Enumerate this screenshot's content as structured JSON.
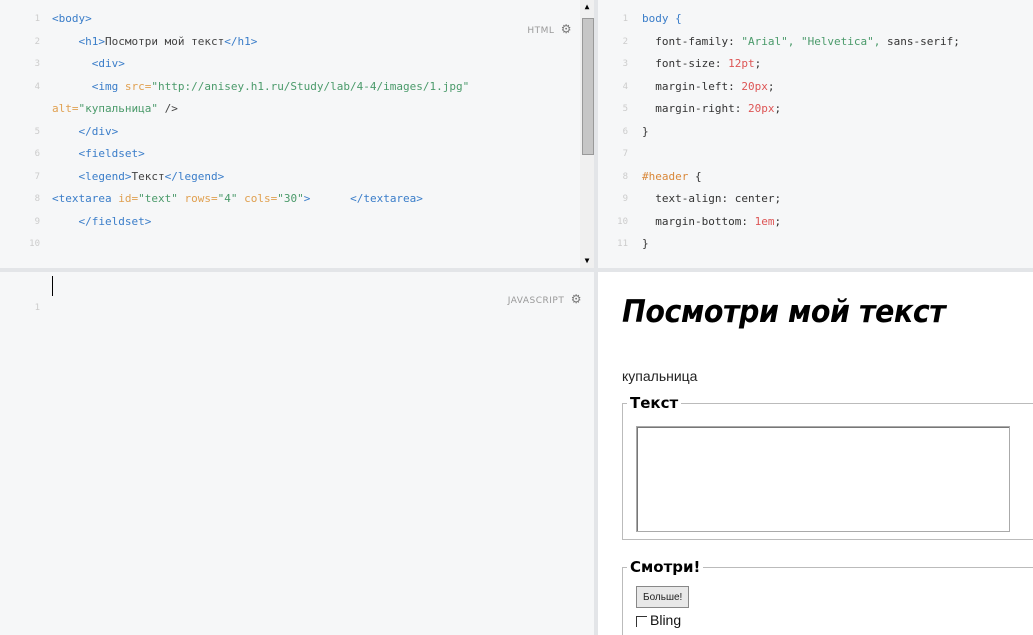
{
  "html_panel": {
    "label": "HTML",
    "line_numbers": [
      "1",
      "2",
      "3",
      "4",
      "",
      "5",
      "6",
      "7",
      "8",
      "9",
      "10",
      ""
    ],
    "lines": [
      [
        {
          "t": "<body>",
          "c": "tag"
        }
      ],
      [
        {
          "t": "    <h1>",
          "c": "tag"
        },
        {
          "t": "Посмотри мой текст",
          "c": "plain"
        },
        {
          "t": "</h1>",
          "c": "tag"
        }
      ],
      [
        {
          "t": "      <div>",
          "c": "tag"
        }
      ],
      [
        {
          "t": "      <img ",
          "c": "tag"
        },
        {
          "t": "src=",
          "c": "attr"
        },
        {
          "t": "\"http://anisey.h1.ru/Study/lab/4-4/images/1.jpg\"",
          "c": "str"
        }
      ],
      [
        {
          "t": "alt=",
          "c": "attr"
        },
        {
          "t": "\"купальница\"",
          "c": "str"
        },
        {
          "t": " />",
          "c": "plain"
        }
      ],
      [
        {
          "t": "    </div>",
          "c": "tag"
        }
      ],
      [
        {
          "t": "    <fieldset>",
          "c": "tag"
        }
      ],
      [
        {
          "t": "    <legend>",
          "c": "tag"
        },
        {
          "t": "Текст",
          "c": "plain"
        },
        {
          "t": "</legend>",
          "c": "tag"
        }
      ],
      [
        {
          "t": "<textarea ",
          "c": "tag"
        },
        {
          "t": "id=",
          "c": "attr"
        },
        {
          "t": "\"text\" ",
          "c": "str"
        },
        {
          "t": "rows=",
          "c": "attr"
        },
        {
          "t": "\"4\" ",
          "c": "str"
        },
        {
          "t": "cols=",
          "c": "attr"
        },
        {
          "t": "\"30\"",
          "c": "str"
        },
        {
          "t": ">      ",
          "c": "tag"
        },
        {
          "t": "</textarea>",
          "c": "tag"
        }
      ],
      [
        {
          "t": "    </fieldset>",
          "c": "tag"
        }
      ],
      [
        {
          "t": "",
          "c": "plain"
        }
      ],
      [
        {
          "t": "",
          "c": "plain"
        }
      ]
    ]
  },
  "css_panel": {
    "line_numbers": [
      "1",
      "2",
      "3",
      "4",
      "5",
      "6",
      "7",
      "8",
      "9",
      "10",
      "11"
    ],
    "lines": [
      [
        {
          "t": "body {",
          "c": "tag"
        }
      ],
      [
        {
          "t": "  font-family: ",
          "c": "prop"
        },
        {
          "t": "\"Arial\", \"Helvetica\", ",
          "c": "str"
        },
        {
          "t": "sans-serif;",
          "c": "kw"
        }
      ],
      [
        {
          "t": "  font-size: ",
          "c": "prop"
        },
        {
          "t": "12pt",
          "c": "num"
        },
        {
          "t": ";",
          "c": "prop"
        }
      ],
      [
        {
          "t": "  margin-left: ",
          "c": "prop"
        },
        {
          "t": "20px",
          "c": "num"
        },
        {
          "t": ";",
          "c": "prop"
        }
      ],
      [
        {
          "t": "  margin-right: ",
          "c": "prop"
        },
        {
          "t": "20px",
          "c": "num"
        },
        {
          "t": ";",
          "c": "prop"
        }
      ],
      [
        {
          "t": "}",
          "c": "prop"
        }
      ],
      [
        {
          "t": "",
          "c": "plain"
        }
      ],
      [
        {
          "t": "#header",
          "c": "sel"
        },
        {
          "t": " {",
          "c": "prop"
        }
      ],
      [
        {
          "t": "  text-align: ",
          "c": "prop"
        },
        {
          "t": "center",
          "c": "kw"
        },
        {
          "t": ";",
          "c": "prop"
        }
      ],
      [
        {
          "t": "  margin-bottom: ",
          "c": "prop"
        },
        {
          "t": "1em",
          "c": "num"
        },
        {
          "t": ";",
          "c": "prop"
        }
      ],
      [
        {
          "t": "}",
          "c": "prop"
        }
      ]
    ]
  },
  "js_panel": {
    "label": "JAVASCRIPT",
    "line_numbers": [
      "1"
    ]
  },
  "result": {
    "title": "Посмотри мой текст",
    "image_alt": "купальница",
    "fieldset1_legend": "Текст",
    "textarea_value": "",
    "fieldset2_legend": "Смотри!",
    "button_label": "Больше!",
    "checkbox_label": "Bling"
  },
  "icons": {
    "settings": "gear-icon",
    "scroll_up": "arrow-up-icon",
    "scroll_down": "arrow-down-icon"
  }
}
